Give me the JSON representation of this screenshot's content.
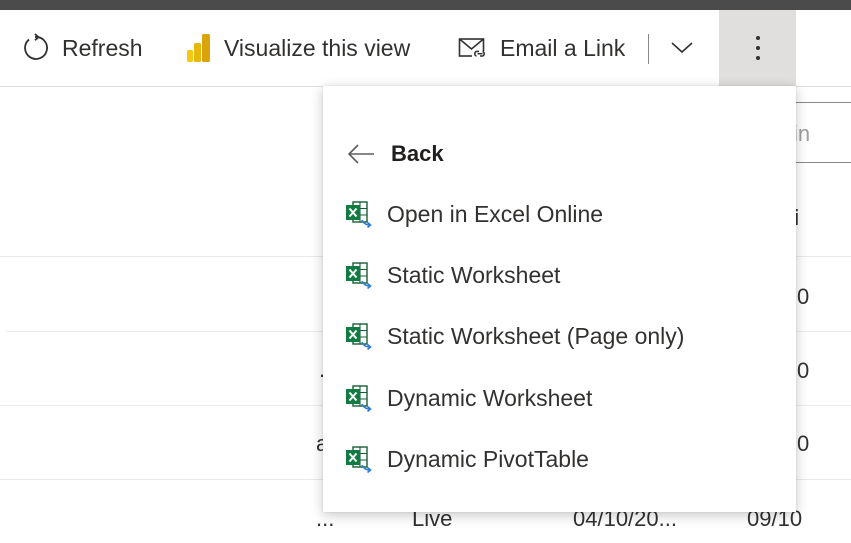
{
  "commandbar": {
    "refresh_label": "Refresh",
    "visualize_label": "Visualize this view",
    "email_label": "Email a Link"
  },
  "background": {
    "search_placeholder_fragment": "in",
    "column_header_fragment": "li",
    "rows": [
      {
        "col_a": "",
        "col_b": "",
        "col_c": "",
        "col_d": "0"
      },
      {
        "col_a": "…",
        "col_b": "",
        "col_c": "",
        "col_d": "0"
      },
      {
        "col_a": "a",
        "col_b": "",
        "col_c": "",
        "col_d": "0"
      },
      {
        "col_a": "...",
        "col_b": "Live",
        "col_c": "04/10/20...",
        "col_d": "09/10"
      }
    ]
  },
  "menu": {
    "back_label": "Back",
    "items": [
      {
        "label": "Open in Excel Online",
        "icon": "excel-icon"
      },
      {
        "label": "Static Worksheet",
        "icon": "excel-icon"
      },
      {
        "label": "Static Worksheet (Page only)",
        "icon": "excel-icon"
      },
      {
        "label": "Dynamic Worksheet",
        "icon": "excel-icon"
      },
      {
        "label": "Dynamic PivotTable",
        "icon": "excel-icon"
      }
    ]
  },
  "colors": {
    "excel_green": "#107c41",
    "excel_dark": "#185c37",
    "powerbi_yellow": "#f2c811",
    "selected_gray": "#e1dfdd"
  }
}
